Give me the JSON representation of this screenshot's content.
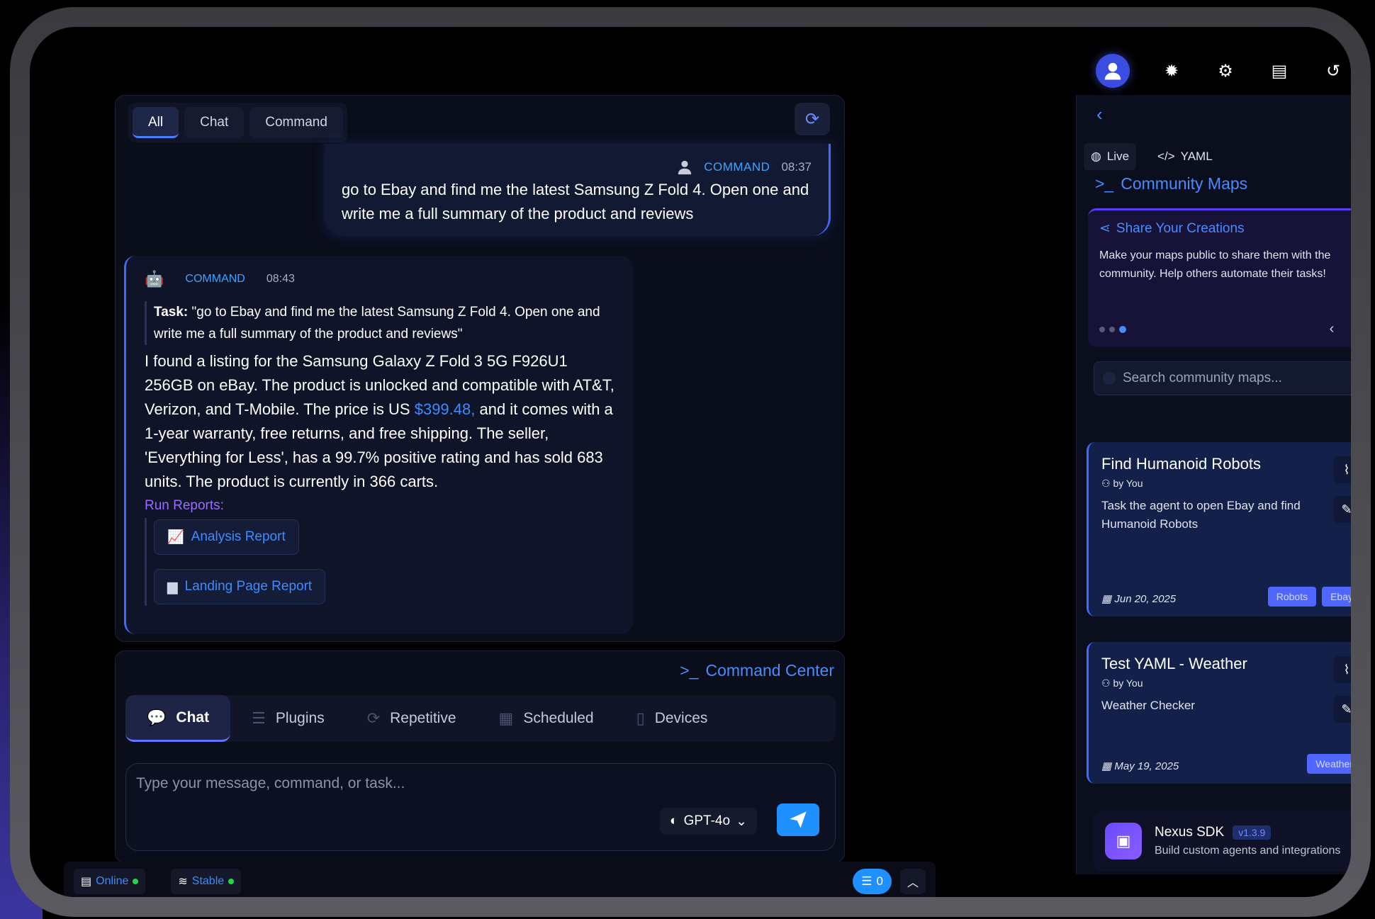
{
  "chat": {
    "tabs": [
      {
        "label": "All"
      },
      {
        "label": "Chat"
      },
      {
        "label": "Command"
      }
    ],
    "user_message": {
      "label": "COMMAND",
      "time": "08:37",
      "text": "go to Ebay and find me the latest Samsung Z Fold 4. Open one and write me a full summary of the product and reviews"
    },
    "bot_message": {
      "label": "COMMAND",
      "time": "08:43",
      "task_label": "Task:",
      "task_text": "\"go to Ebay and find me the latest Samsung Z Fold 4. Open one and write me a full summary of the product and reviews\"",
      "answer_part1": "I found a listing for the Samsung Galaxy Z Fold 3 5G F926U1 256GB on eBay. The product is unlocked and compatible with AT&T, Verizon, and T-Mobile. The price is US",
      "price": "$399.48,",
      "answer_part2": "and it comes with a 1-year warranty, free returns, and free shipping. The seller, 'Everything for Less', has a 99.7% positive rating and has sold 683 units. The product is currently in 366 carts.",
      "reports_label": "Run Reports:",
      "reports": [
        {
          "label": "Analysis Report",
          "icon": "chart-icon"
        },
        {
          "label": "Landing Page Report",
          "icon": "file-icon"
        }
      ]
    }
  },
  "command_center": {
    "title": "Command Center",
    "modes": [
      {
        "label": "Chat",
        "icon": "chat-icon"
      },
      {
        "label": "Plugins",
        "icon": "list-icon"
      },
      {
        "label": "Repetitive",
        "icon": "repeat-icon"
      },
      {
        "label": "Scheduled",
        "icon": "calendar-icon"
      },
      {
        "label": "Devices",
        "icon": "device-icon"
      }
    ],
    "input_placeholder": "Type your message, command, or task...",
    "model": "GPT-4o"
  },
  "status": {
    "online": "Online",
    "stable": "Stable",
    "counter": "0"
  },
  "right": {
    "tabs": [
      {
        "label": "Live"
      },
      {
        "label": "YAML"
      }
    ],
    "title": "Community Maps",
    "share": {
      "title": "Share Your Creations",
      "text": "Make your maps public to share them with the community. Help others automate their tasks!"
    },
    "search_placeholder": "Search community maps...",
    "cards": [
      {
        "title": "Find Humanoid Robots",
        "by": "by You",
        "desc": "Task the agent to open Ebay and find Humanoid Robots",
        "date": "Jun 20, 2025",
        "tags": [
          "Robots",
          "Ebay"
        ]
      },
      {
        "title": "Test YAML - Weather",
        "by": "by You",
        "desc": "Weather Checker",
        "date": "May 19, 2025",
        "tags": [
          "Weather"
        ]
      }
    ],
    "sdk": {
      "title": "Nexus SDK",
      "version": "v1.3.9",
      "desc": "Build custom agents and integrations"
    }
  }
}
